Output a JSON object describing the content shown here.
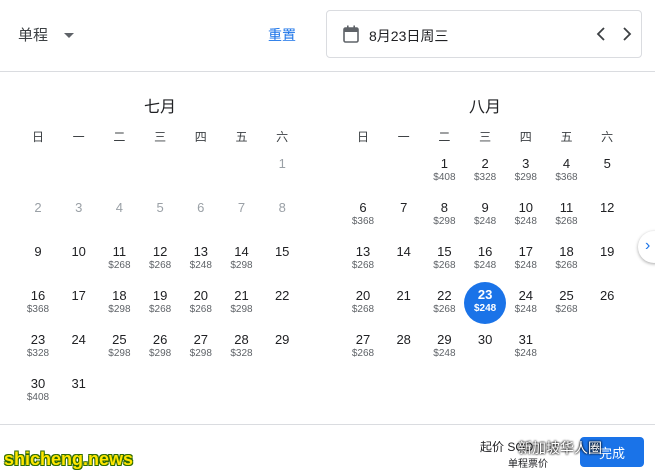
{
  "toolbar": {
    "trip_type": "单程",
    "reset_label": "重置",
    "selected_date": "8月23日周三"
  },
  "weekdays": [
    "日",
    "一",
    "二",
    "三",
    "四",
    "五",
    "六"
  ],
  "months": [
    {
      "title": "七月",
      "offset": 6,
      "days": [
        {
          "d": "1",
          "p": "",
          "m": true
        },
        {
          "d": "2",
          "p": "",
          "m": true
        },
        {
          "d": "3",
          "p": "",
          "m": true
        },
        {
          "d": "4",
          "p": "",
          "m": true
        },
        {
          "d": "5",
          "p": "",
          "m": true
        },
        {
          "d": "6",
          "p": "",
          "m": true
        },
        {
          "d": "7",
          "p": "",
          "m": true
        },
        {
          "d": "8",
          "p": "",
          "m": true
        },
        {
          "d": "9",
          "p": ""
        },
        {
          "d": "10",
          "p": ""
        },
        {
          "d": "11",
          "p": "$268"
        },
        {
          "d": "12",
          "p": "$268"
        },
        {
          "d": "13",
          "p": "$248"
        },
        {
          "d": "14",
          "p": "$298"
        },
        {
          "d": "15",
          "p": ""
        },
        {
          "d": "16",
          "p": "$368"
        },
        {
          "d": "17",
          "p": ""
        },
        {
          "d": "18",
          "p": "$298"
        },
        {
          "d": "19",
          "p": "$268"
        },
        {
          "d": "20",
          "p": "$268"
        },
        {
          "d": "21",
          "p": "$298"
        },
        {
          "d": "22",
          "p": ""
        },
        {
          "d": "23",
          "p": "$328"
        },
        {
          "d": "24",
          "p": ""
        },
        {
          "d": "25",
          "p": "$298"
        },
        {
          "d": "26",
          "p": "$298"
        },
        {
          "d": "27",
          "p": "$298"
        },
        {
          "d": "28",
          "p": "$328"
        },
        {
          "d": "29",
          "p": ""
        },
        {
          "d": "30",
          "p": "$408"
        },
        {
          "d": "31",
          "p": ""
        }
      ]
    },
    {
      "title": "八月",
      "offset": 2,
      "days": [
        {
          "d": "1",
          "p": "$408"
        },
        {
          "d": "2",
          "p": "$328"
        },
        {
          "d": "3",
          "p": "$298"
        },
        {
          "d": "4",
          "p": "$368"
        },
        {
          "d": "5",
          "p": ""
        },
        {
          "d": "6",
          "p": "$368"
        },
        {
          "d": "7",
          "p": ""
        },
        {
          "d": "8",
          "p": "$298"
        },
        {
          "d": "9",
          "p": "$248"
        },
        {
          "d": "10",
          "p": "$248"
        },
        {
          "d": "11",
          "p": "$268"
        },
        {
          "d": "12",
          "p": ""
        },
        {
          "d": "13",
          "p": "$268"
        },
        {
          "d": "14",
          "p": ""
        },
        {
          "d": "15",
          "p": "$268"
        },
        {
          "d": "16",
          "p": "$248"
        },
        {
          "d": "17",
          "p": "$248"
        },
        {
          "d": "18",
          "p": "$268"
        },
        {
          "d": "19",
          "p": ""
        },
        {
          "d": "20",
          "p": "$268"
        },
        {
          "d": "21",
          "p": ""
        },
        {
          "d": "22",
          "p": "$268"
        },
        {
          "d": "23",
          "p": "$248",
          "s": true
        },
        {
          "d": "24",
          "p": "$248"
        },
        {
          "d": "25",
          "p": "$268"
        },
        {
          "d": "26",
          "p": ""
        },
        {
          "d": "27",
          "p": "$268"
        },
        {
          "d": "28",
          "p": ""
        },
        {
          "d": "29",
          "p": "$248"
        },
        {
          "d": "30",
          "p": ""
        },
        {
          "d": "31",
          "p": "$248"
        }
      ]
    }
  ],
  "footer": {
    "start_price": "起价 SGD",
    "done_label": "完成"
  },
  "watermark": {
    "text": "shicheng.news",
    "account": "新加坡华人圈",
    "sub": "单程票价"
  },
  "colors": {
    "accent": "#1a73e8",
    "muted": "#9aa0a6"
  }
}
